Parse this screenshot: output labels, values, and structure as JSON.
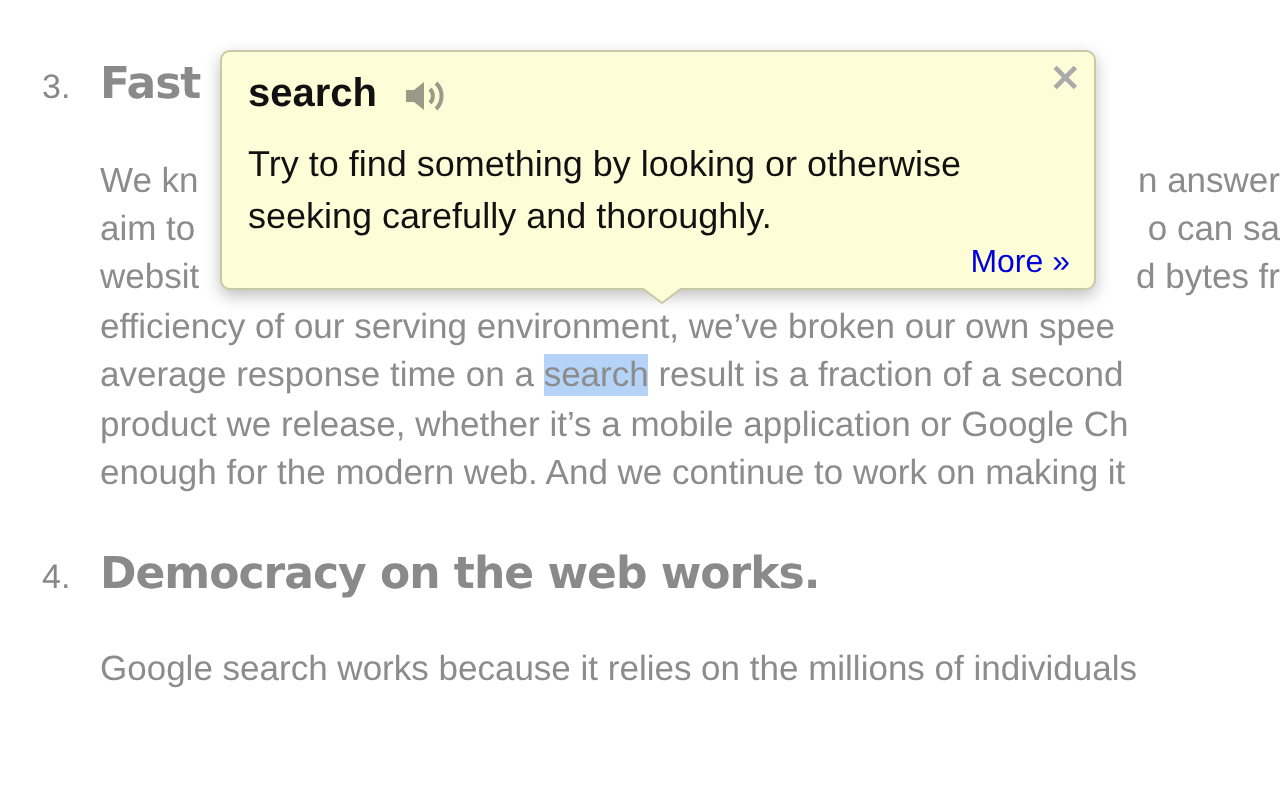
{
  "sections": [
    {
      "number": "3.",
      "heading": "Fast",
      "lines": [
        {
          "left": "We kn",
          "right": "n answer"
        },
        {
          "left": "aim to",
          "right": "o can sa"
        },
        {
          "left": "websit",
          "right": "d bytes fr"
        },
        {
          "parts": [
            {
              "text": "efficiency of our serving environment, we’ve broken our own spee",
              "selected": false
            }
          ]
        },
        {
          "parts": [
            {
              "text": "average response time on a ",
              "selected": false
            },
            {
              "text": "search",
              "selected": true
            },
            {
              "text": " result is a fraction of a second",
              "selected": false
            }
          ]
        },
        {
          "parts": [
            {
              "text": "product we release, whether it’s a mobile application or Google Ch",
              "selected": false
            }
          ]
        },
        {
          "parts": [
            {
              "text": "enough for the modern web. And we continue to work on making it",
              "selected": false
            }
          ]
        }
      ]
    },
    {
      "number": "4.",
      "heading": "Democracy on the web works.",
      "lines": [
        {
          "parts": [
            {
              "text": "Google search works because it relies on the millions of individuals",
              "selected": false
            }
          ]
        }
      ]
    }
  ],
  "popup": {
    "word": "search",
    "definition": "Try to find something by looking or otherwise seeking carefully and thoroughly.",
    "more_link": "More »",
    "close": "×"
  }
}
